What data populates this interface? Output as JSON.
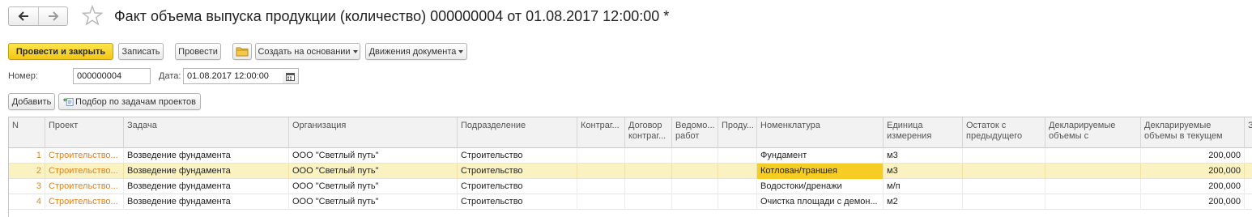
{
  "header": {
    "title": "Факт объема выпуска продукции (количество) 000000004 от 01.08.2017 12:00:00 *"
  },
  "toolbar": {
    "post_close": "Провести и закрыть",
    "write": "Записать",
    "post": "Провести",
    "create_based": "Создать на основании",
    "doc_movements": "Движения документа"
  },
  "form": {
    "number_label": "Номер:",
    "number_value": "000000004",
    "date_label": "Дата:",
    "date_value": "01.08.2017 12:00:00"
  },
  "table_toolbar": {
    "add": "Добавить",
    "pick": "Подбор по задачам проектов"
  },
  "table": {
    "columns": [
      "N",
      "Проект",
      "Задача",
      "Организация",
      "Подразделение",
      "Контраг...",
      "Договор контраг...",
      "Ведомо... работ",
      "Проду...",
      "Номенклатура",
      "Единица измерения",
      "Остаток с предыдущего",
      "Декларируемые объемы с",
      "Декларируемые объемы в текущем",
      "З"
    ],
    "rows": [
      [
        "1",
        "Строительство...",
        "Возведение фундамента",
        "ООО \"Светлый путь\"",
        "Строительство",
        "",
        "",
        "",
        "",
        "Фундамент",
        "м3",
        "",
        "",
        "200,000"
      ],
      [
        "2",
        "Строительство...",
        "Возведение фундамента",
        "ООО \"Светлый путь\"",
        "Строительство",
        "",
        "",
        "",
        "",
        "Котлован/траншея",
        "м3",
        "",
        "",
        "200,000"
      ],
      [
        "3",
        "Строительство...",
        "Возведение фундамента",
        "ООО \"Светлый путь\"",
        "Строительство",
        "",
        "",
        "",
        "",
        "Водостоки/дренажи",
        "м/п",
        "",
        "",
        "200,000"
      ],
      [
        "4",
        "Строительство...",
        "Возведение фундамента",
        "ООО \"Светлый путь\"",
        "Строительство",
        "",
        "",
        "",
        "",
        "Очистка площади с демон...",
        "м2",
        "",
        "",
        "200,000"
      ]
    ]
  },
  "colors": {
    "primary_button": "#f5cc1c",
    "selected_row": "#fbf2c2",
    "active_cell": "#f6cd22",
    "link_orange": "#e0821a"
  },
  "icons": {
    "back": "arrow-left-icon",
    "forward": "arrow-right-icon",
    "favorite": "star-icon",
    "folder": "folder-icon",
    "calendar": "calendar-icon",
    "pick": "pick-tasks-icon"
  }
}
